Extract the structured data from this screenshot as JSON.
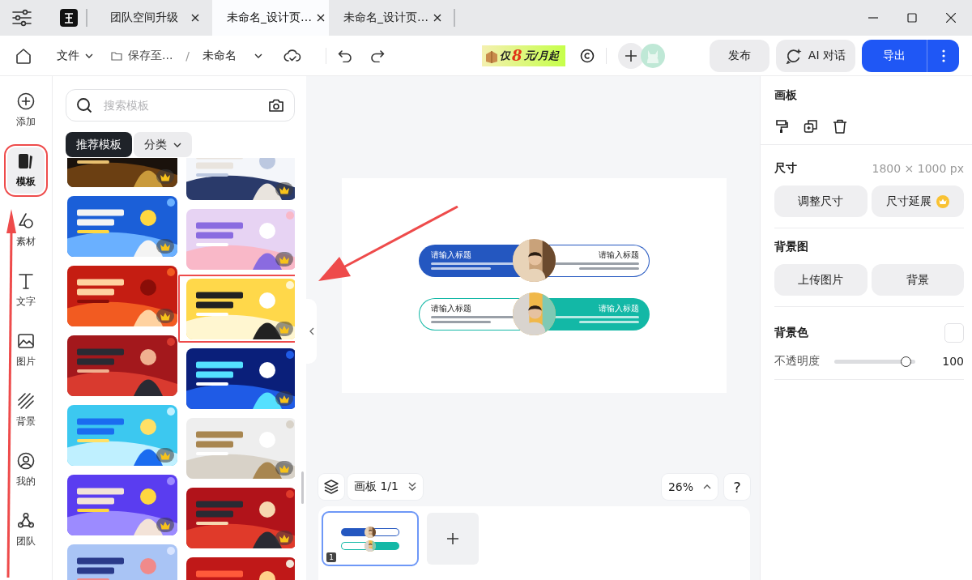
{
  "browser_tabs": [
    {
      "label": "团队空间升级",
      "selected": false
    },
    {
      "label": "未命名_设计页…",
      "selected": true
    },
    {
      "label": "未命名_设计页…",
      "selected": false
    }
  ],
  "toolbar": {
    "file_menu": "文件",
    "save_location": "保存至...",
    "separator": "/",
    "document_name": "未命名",
    "promo": {
      "prefix": "仅",
      "number": "8",
      "suffix": "元/月起"
    },
    "publish": "发布",
    "ai_chat": "AI 对话",
    "export": "导出"
  },
  "rail": [
    {
      "label": "添加",
      "selected": false,
      "annotated": false
    },
    {
      "label": "模板",
      "selected": true,
      "annotated": true
    },
    {
      "label": "素材",
      "selected": false,
      "annotated": false
    },
    {
      "label": "文字",
      "selected": false,
      "annotated": false
    },
    {
      "label": "图片",
      "selected": false,
      "annotated": false
    },
    {
      "label": "背景",
      "selected": false,
      "annotated": false
    },
    {
      "label": "我的",
      "selected": false,
      "annotated": false
    },
    {
      "label": "团队",
      "selected": false,
      "annotated": false
    }
  ],
  "template_panel": {
    "search_placeholder": "搜索模板",
    "filters": [
      {
        "label": "推荐模板",
        "selected": true,
        "kind": "tab"
      },
      {
        "label": "分类",
        "selected": false,
        "kind": "dropdown"
      }
    ],
    "columns": [
      [
        {
          "kind": "picture",
          "premium": true
        },
        {
          "kind": "picture",
          "premium": true
        },
        {
          "kind": "picture",
          "premium": true
        },
        {
          "kind": "picture"
        },
        {
          "kind": "picture",
          "premium": true
        },
        {
          "kind": "picture",
          "premium": true
        },
        {
          "kind": "picture"
        }
      ],
      [
        {
          "kind": "picture",
          "premium": true
        },
        {
          "kind": "picture",
          "premium": true
        },
        {
          "kind": "picture",
          "premium": true,
          "annotated": true
        },
        {
          "kind": "picture",
          "premium": true
        },
        {
          "kind": "picture",
          "premium": true
        },
        {
          "kind": "picture",
          "premium": true
        },
        {
          "kind": "picture"
        }
      ]
    ]
  },
  "canvas": {
    "rows": [
      {
        "color": "#2457c0",
        "halves": [
          {
            "title": "请输入标题",
            "filled": true
          },
          {
            "title": "请输入标题",
            "filled": false
          }
        ]
      },
      {
        "color": "#13b8a6",
        "halves": [
          {
            "title": "请输入标题",
            "filled": false
          },
          {
            "title": "请输入标题",
            "filled": true
          }
        ]
      }
    ],
    "artboard_menu": "画板 1/1",
    "zoom": "26%",
    "help": "?",
    "pages": [
      {
        "number": "1",
        "selected": true
      }
    ]
  },
  "properties": {
    "title": "画板",
    "size_label": "尺寸",
    "size_value": "1800 × 1000 px",
    "size_buttons": [
      {
        "label": "调整尺寸",
        "premium": false
      },
      {
        "label": "尺寸延展",
        "premium": true
      }
    ],
    "bg_image_label": "背景图",
    "bg_image_buttons": [
      "上传图片",
      "背景"
    ],
    "bg_color_label": "背景色",
    "opacity_label": "不透明度",
    "opacity": {
      "level": 1,
      "reading": "100"
    }
  }
}
